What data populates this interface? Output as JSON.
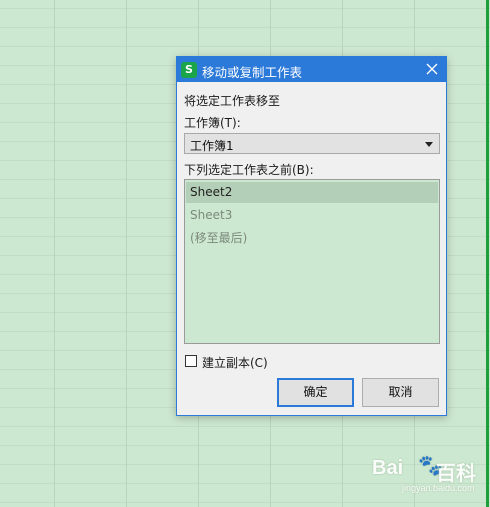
{
  "dialog": {
    "title": "移动或复制工作表",
    "app_icon": "S",
    "move_label": "将选定工作表移至",
    "workbook_label": "工作簿(T):",
    "workbook_value": "工作簿1",
    "before_label": "下列选定工作表之前(B):",
    "sheets": [
      {
        "label": "Sheet2",
        "state": "selected"
      },
      {
        "label": "Sheet3",
        "state": "normal"
      },
      {
        "label": "(移至最后)",
        "state": "normal"
      }
    ],
    "create_copy_label": "建立副本(C)",
    "create_copy_checked": false,
    "ok_label": "确定",
    "cancel_label": "取消"
  },
  "watermark": {
    "brand_left": "Bai",
    "brand_right": "百科",
    "sub": "jingyan.baidu.com"
  },
  "colors": {
    "title_bar": "#2b79d8",
    "sheet_bg": "#cde8d0",
    "selection": "#b4cfb7",
    "app_icon": "#1aa54a"
  }
}
